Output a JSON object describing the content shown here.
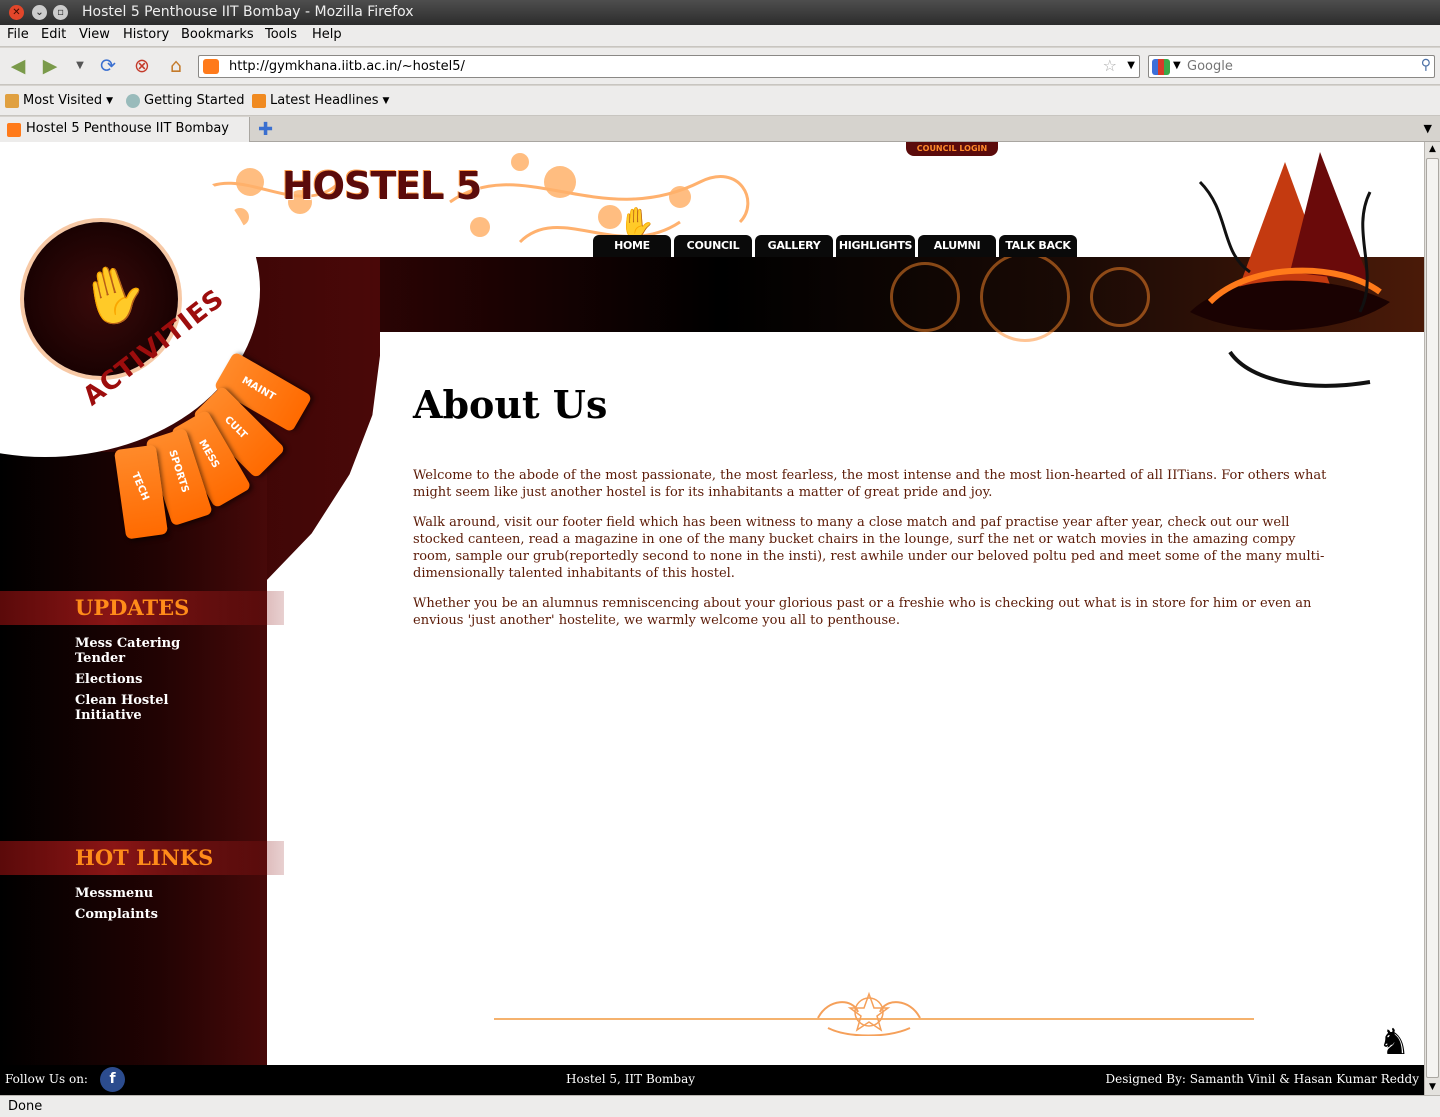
{
  "window": {
    "title": "Hostel 5 Penthouse IIT Bombay - Mozilla Firefox"
  },
  "menu": [
    "File",
    "Edit",
    "View",
    "History",
    "Bookmarks",
    "Tools",
    "Help"
  ],
  "nav": {
    "url": "http://gymkhana.iitb.ac.in/~hostel5/",
    "search_placeholder": "Google"
  },
  "bookmarks": [
    "Most Visited",
    "Getting Started",
    "Latest Headlines"
  ],
  "tab": {
    "label": "Hostel 5 Penthouse IIT Bombay"
  },
  "site": {
    "logo": "HOSTEL 5",
    "council_login": "COUNCIL LOGIN",
    "nav_tabs": [
      "HOME",
      "COUNCIL",
      "GALLERY",
      "HIGHLIGHTS",
      "ALUMNI",
      "TALK BACK"
    ],
    "activities_title": "ACTIVITIES",
    "activities": [
      "MAINT",
      "CULT",
      "MESS",
      "SPORTS",
      "TECH"
    ],
    "updates": {
      "heading": "UPDATES",
      "items": [
        "Mess Catering Tender",
        "Elections",
        "Clean Hostel Initiative"
      ]
    },
    "hot_links": {
      "heading": "HOT LINKS",
      "items": [
        "Messmenu",
        "Complaints"
      ]
    },
    "content": {
      "heading": "About Us",
      "paragraphs": [
        "Welcome to the abode of the most passionate, the most fearless, the most intense and the most lion-hearted of all IITians. For others what might seem like just another hostel is for its inhabitants a matter of great pride and joy.",
        "Walk around, visit our footer field which has been witness to many a close match and paf practise year after year, check out our well stocked canteen, read a magazine in one of the many bucket chairs in the lounge, surf the net or watch movies in the amazing compy room, sample our grub(reportedly second to none in the insti), rest awhile under our beloved poltu ped and meet some of the many multi-dimensionally talented inhabitants of this hostel.",
        "Whether you be an alumnus remniscencing about your glorious past or a freshie who is checking out what is in store for him or even an envious 'just another' hostelite, we warmly welcome you all to penthouse."
      ]
    },
    "footer": {
      "follow": "Follow Us on:",
      "facebook": "f",
      "center": "Hostel 5, IIT Bombay",
      "designer": "Designed By: Samanth Vinil & Hasan Kumar Reddy"
    }
  },
  "status": "Done",
  "colors": {
    "accent_orange": "#ff7a1a",
    "maroon": "#5b0b0b",
    "text_brown": "#5b1a06"
  }
}
